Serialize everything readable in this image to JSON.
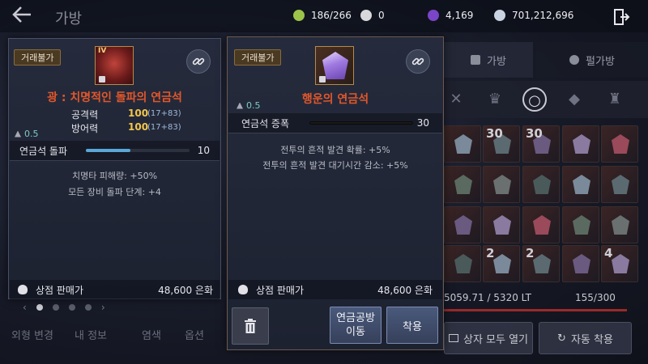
{
  "header": {
    "title": "가방",
    "currencies": [
      {
        "icon": "green-stone-icon",
        "value": "186/266",
        "color": "#9cc44a"
      },
      {
        "icon": "pearl-icon",
        "value": "0",
        "color": "#d8d8dc"
      },
      {
        "icon": "purple-gem-icon",
        "value": "4,169",
        "color": "#7b45c8"
      },
      {
        "icon": "silver-coin-icon",
        "value": "701,212,696",
        "color": "#c9d3e2"
      }
    ]
  },
  "tabs": {
    "bag": "가방",
    "pet_bag": "펄가방"
  },
  "left_card": {
    "tradeable": "거래불가",
    "level_badge": "IV",
    "name": "광 : 치명적인 돌파의 연금석",
    "name_color": "#e2572b",
    "stats": [
      {
        "label": "공격력",
        "value": "100",
        "sub": "(17+83)"
      },
      {
        "label": "방어력",
        "value": "100",
        "sub": "(17+83)"
      }
    ],
    "weight": "0.5",
    "bar_label": "연금석 돌파",
    "bar_value": "10",
    "bar_fill": 0.43,
    "effects": [
      "치명타 피해량: +50%",
      "모든 장비 돌파 단계: +4"
    ],
    "sell_label": "상점 판매가",
    "sell_price": "48,600 은화"
  },
  "right_card": {
    "tradeable": "거래불가",
    "name": "행운의 연금석",
    "name_color": "#e2572b",
    "weight": "0.5",
    "bar_label": "연금석 증폭",
    "bar_value": "30",
    "bar_fill": 1.0,
    "effects": [
      "전투의 흔적 발견 확률: +5%",
      "전투의 흔적 발견 대기시간 감소: +5%"
    ],
    "sell_label": "상점 판매가",
    "sell_price": "48,600 은화"
  },
  "actions": {
    "move_lab": "연금공방\n이동",
    "equip": "착용"
  },
  "inventory": {
    "weight": "5059.71 / 5320 LT",
    "slots": "155/300",
    "open_all": "상자 모두 열기",
    "auto_equip": "자동 착용",
    "stack_labels": [
      "30",
      "30",
      "2",
      "2",
      "4"
    ]
  },
  "bottom_nav": [
    "외형 변경",
    "내 정보",
    "염색",
    "옵션"
  ]
}
